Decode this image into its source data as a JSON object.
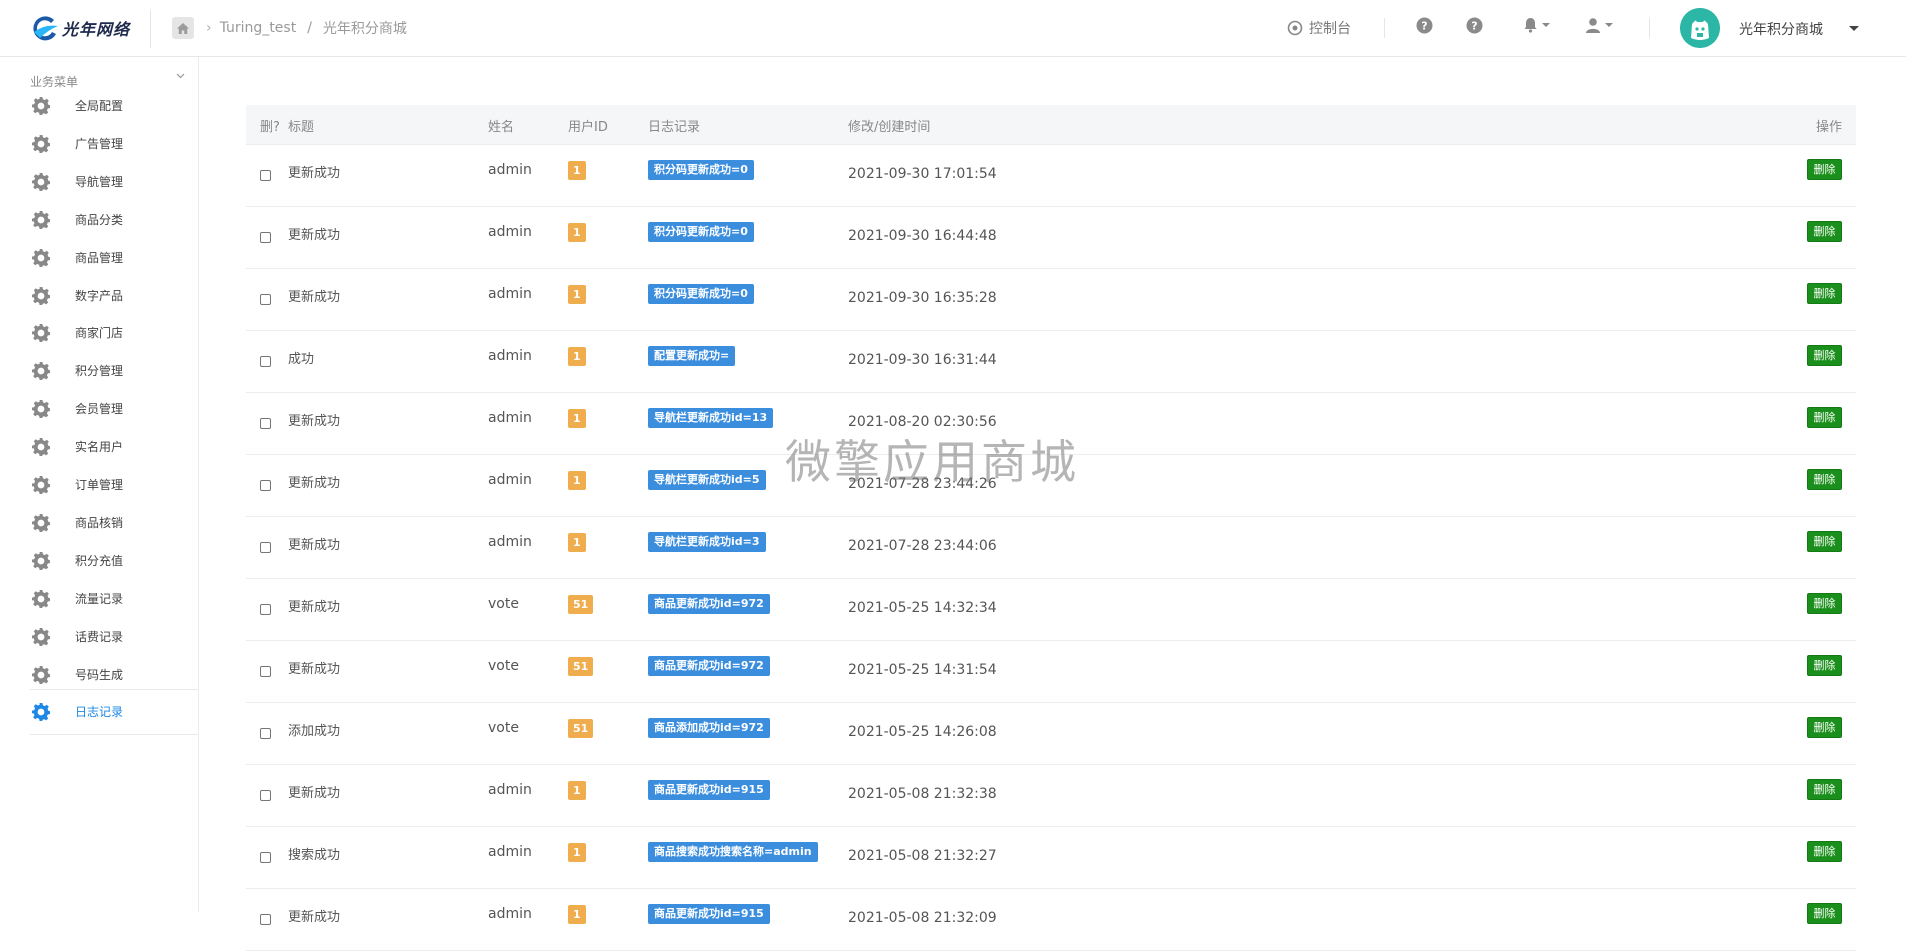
{
  "header": {
    "logo_text": "光年网络",
    "breadcrumb": {
      "app": "Turing_test",
      "page": "光年积分商城"
    },
    "console_label": "控制台",
    "user_name": "光年积分商城"
  },
  "sidebar": {
    "heading": "业务菜单",
    "items": [
      {
        "label": "全局配置"
      },
      {
        "label": "广告管理"
      },
      {
        "label": "导航管理"
      },
      {
        "label": "商品分类"
      },
      {
        "label": "商品管理"
      },
      {
        "label": "数字产品"
      },
      {
        "label": "商家门店"
      },
      {
        "label": "积分管理"
      },
      {
        "label": "会员管理"
      },
      {
        "label": "实名用户"
      },
      {
        "label": "订单管理"
      },
      {
        "label": "商品核销"
      },
      {
        "label": "积分充值"
      },
      {
        "label": "流量记录"
      },
      {
        "label": "话费记录"
      },
      {
        "label": "号码生成"
      },
      {
        "label": "日志记录"
      }
    ],
    "active_index": 16
  },
  "table": {
    "headers": {
      "del": "删?",
      "title": "标题",
      "name": "姓名",
      "uid": "用户ID",
      "log": "日志记录",
      "time": "修改/创建时间",
      "action": "操作"
    },
    "delete_label": "删除",
    "rows": [
      {
        "title": "更新成功",
        "name": "admin",
        "uid": "1",
        "log": "积分码更新成功=0",
        "time": "2021-09-30 17:01:54"
      },
      {
        "title": "更新成功",
        "name": "admin",
        "uid": "1",
        "log": "积分码更新成功=0",
        "time": "2021-09-30 16:44:48"
      },
      {
        "title": "更新成功",
        "name": "admin",
        "uid": "1",
        "log": "积分码更新成功=0",
        "time": "2021-09-30 16:35:28"
      },
      {
        "title": "成功",
        "name": "admin",
        "uid": "1",
        "log": "配置更新成功=",
        "time": "2021-09-30 16:31:44"
      },
      {
        "title": "更新成功",
        "name": "admin",
        "uid": "1",
        "log": "导航栏更新成功id=13",
        "time": "2021-08-20 02:30:56"
      },
      {
        "title": "更新成功",
        "name": "admin",
        "uid": "1",
        "log": "导航栏更新成功id=5",
        "time": "2021-07-28 23:44:26"
      },
      {
        "title": "更新成功",
        "name": "admin",
        "uid": "1",
        "log": "导航栏更新成功id=3",
        "time": "2021-07-28 23:44:06"
      },
      {
        "title": "更新成功",
        "name": "vote",
        "uid": "51",
        "log": "商品更新成功id=972",
        "time": "2021-05-25 14:32:34"
      },
      {
        "title": "更新成功",
        "name": "vote",
        "uid": "51",
        "log": "商品更新成功id=972",
        "time": "2021-05-25 14:31:54"
      },
      {
        "title": "添加成功",
        "name": "vote",
        "uid": "51",
        "log": "商品添加成功id=972",
        "time": "2021-05-25 14:26:08"
      },
      {
        "title": "更新成功",
        "name": "admin",
        "uid": "1",
        "log": "商品更新成功id=915",
        "time": "2021-05-08 21:32:38"
      },
      {
        "title": "搜索成功",
        "name": "admin",
        "uid": "1",
        "log": "商品搜索成功搜索名称=admin",
        "time": "2021-05-08 21:32:27"
      },
      {
        "title": "更新成功",
        "name": "admin",
        "uid": "1",
        "log": "商品更新成功id=915",
        "time": "2021-05-08 21:32:09"
      }
    ]
  },
  "watermark": "微擎应用商城",
  "colors": {
    "uid_badge": "#f0ad4e",
    "log_badge": "#3b8ede",
    "delete_button": "#1b8f1b",
    "active_menu": "#1e88e5"
  }
}
